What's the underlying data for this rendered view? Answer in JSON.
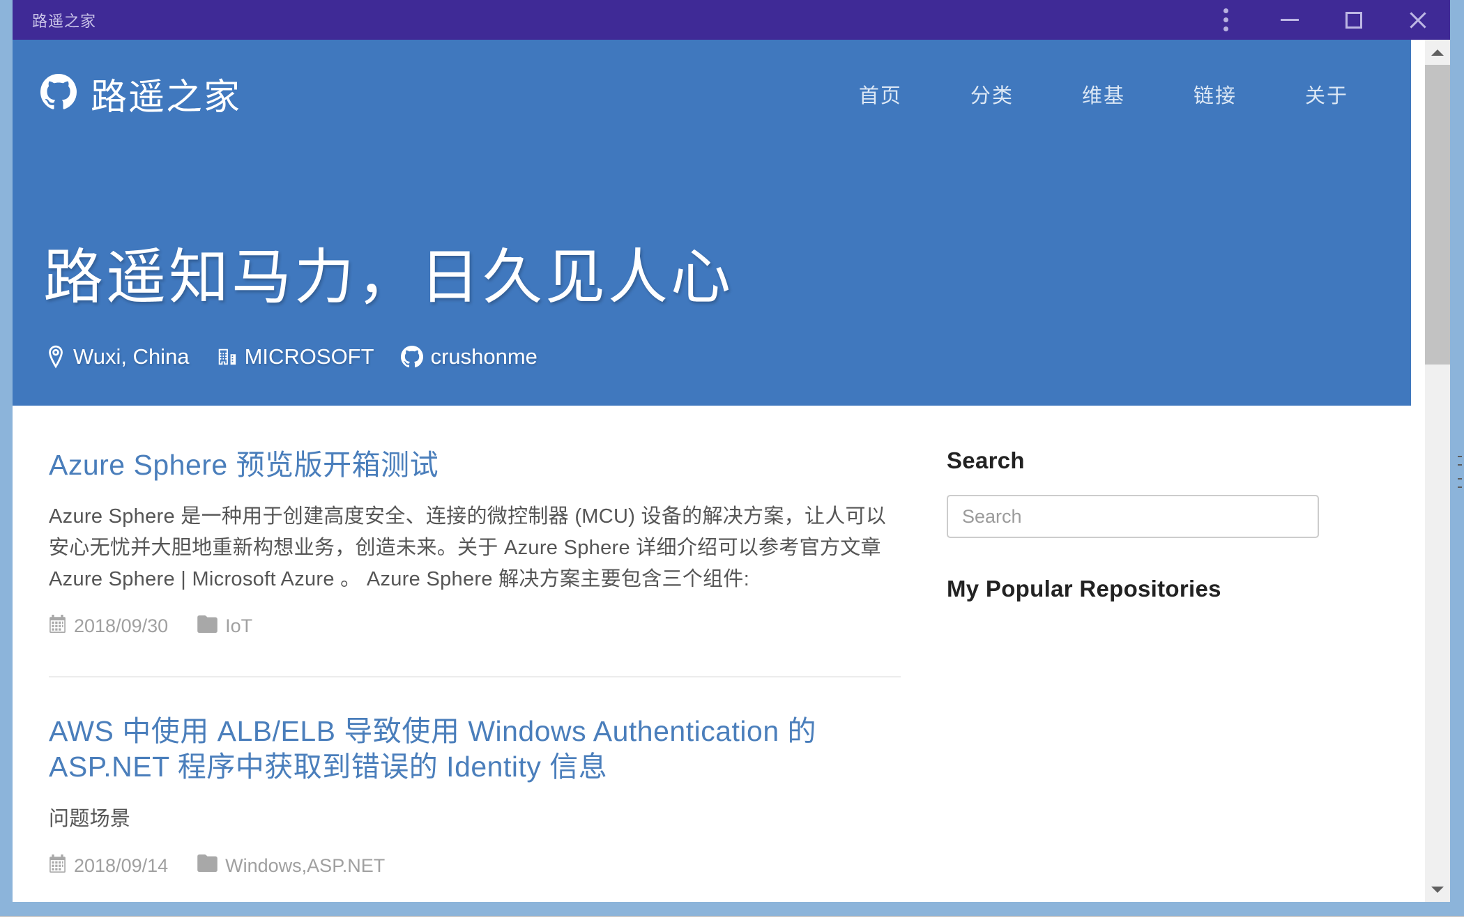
{
  "window": {
    "title": "路遥之家",
    "controls": {
      "menu_label": "more-options",
      "minimize_label": "minimize",
      "maximize_label": "maximize",
      "close_label": "close"
    }
  },
  "site_header": {
    "brand_name": "路遥之家",
    "brand_icon": "github-icon",
    "nav": [
      {
        "label": "首页"
      },
      {
        "label": "分类"
      },
      {
        "label": "维基"
      },
      {
        "label": "链接"
      },
      {
        "label": "关于"
      }
    ]
  },
  "hero": {
    "title": "路遥知马力，日久见人心",
    "background_color": "#4078be",
    "meta": [
      {
        "icon": "location-pin-icon",
        "label": "Wuxi, China"
      },
      {
        "icon": "organization-icon",
        "label": "MICROSOFT"
      },
      {
        "icon": "github-icon",
        "label": "crushonme"
      }
    ]
  },
  "posts": [
    {
      "title": "Azure Sphere 预览版开箱测试",
      "excerpt": "Azure Sphere 是一种用于创建高度安全、连接的微控制器 (MCU) 设备的解决方案，让人可以安心无忧并大胆地重新构想业务，创造未来。关于 Azure Sphere 详细介绍可以参考官方文章 Azure Sphere | Microsoft Azure 。 Azure Sphere 解决方案主要包含三个组件:",
      "date": "2018/09/30",
      "category": "IoT",
      "date_icon": "calendar-icon",
      "category_icon": "folder-icon"
    },
    {
      "title": "AWS 中使用 ALB/ELB 导致使用 Windows Authentication 的 ASP.NET 程序中获取到错误的 Identity 信息",
      "excerpt": "问题场景",
      "date": "2018/09/14",
      "category": "Windows,ASP.NET",
      "date_icon": "calendar-icon",
      "category_icon": "folder-icon"
    }
  ],
  "sidebar": {
    "search_heading": "Search",
    "search_placeholder": "Search",
    "search_value": "",
    "repos_heading": "My Popular Repositories"
  },
  "colors": {
    "titlebar": "#3f2a96",
    "hero": "#4078be",
    "link": "#4a7ebb",
    "meta_text": "#a0a0a0",
    "frame": "#8cb4da"
  }
}
